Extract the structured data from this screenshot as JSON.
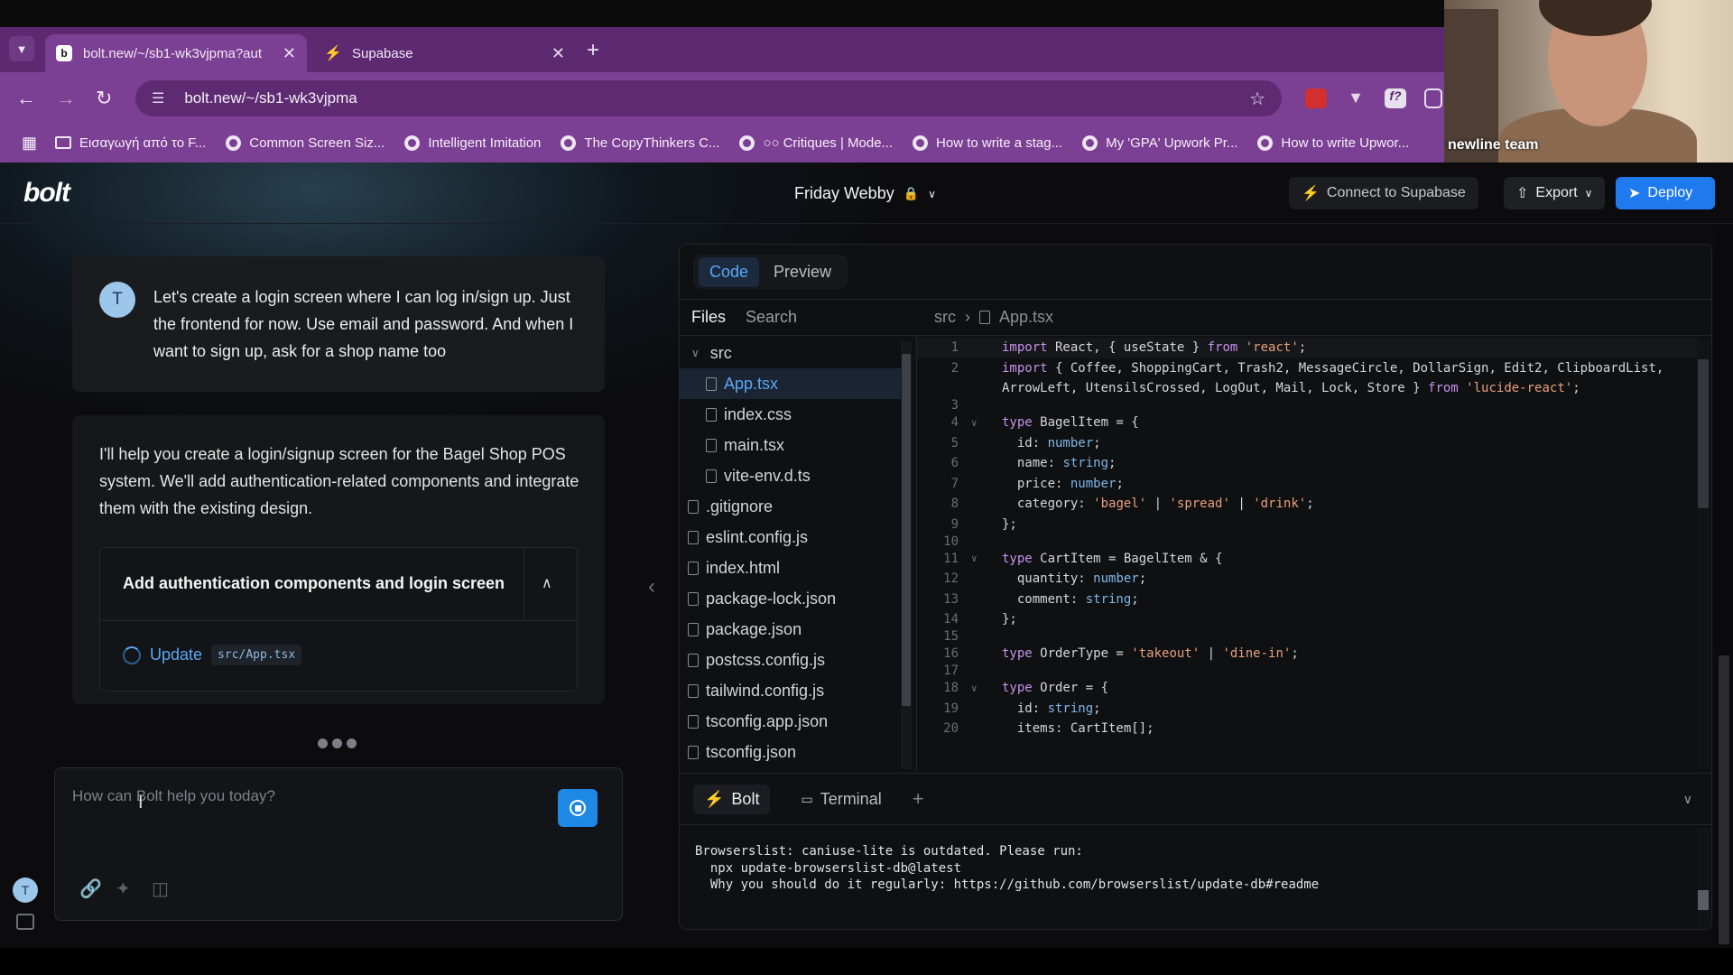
{
  "browser": {
    "tabs": [
      {
        "title": "bolt.new/~/sb1-wk3vjpma?aut",
        "favicon": "b"
      },
      {
        "title": "Supabase",
        "favicon": "supabase-icon"
      }
    ],
    "url": "bolt.new/~/sb1-wk3vjpma",
    "bookmarks": [
      "Εισαγωγή από το F...",
      "Common Screen Siz...",
      "Intelligent Imitation",
      "The CopyThinkers C...",
      "Critiques | Mode...",
      "How to write a stag...",
      "My 'GPA' Upwork Pr...",
      "How to write Upwor..."
    ],
    "theme_color": "#7b3f93"
  },
  "webcam": {
    "label": "newline team"
  },
  "app": {
    "logo": "bolt",
    "project_name": "Friday Webby",
    "connect_label": "Connect to Supabase",
    "export_label": "Export",
    "deploy_label": "Deploy",
    "accent": "#1f7af0"
  },
  "chat": {
    "user_avatar": "T",
    "user_message": "Let's create a login screen where I can log in/sign up. Just the frontend for now. Use email and password. And when I want to sign up, ask for a shop name too",
    "assistant_message": "I'll help you create a login/signup screen for the Bagel Shop POS system. We'll add authentication-related components and integrate them with the existing design.",
    "action_title": "Add authentication components and login screen",
    "action_step": "Update",
    "action_file": "src/App.tsx",
    "input_placeholder": "How can Bolt help you today?",
    "sidebar_avatar": "T"
  },
  "workbench": {
    "tabs": [
      "Code",
      "Preview"
    ],
    "active_tab": "Code",
    "file_tabs": [
      "Files",
      "Search"
    ],
    "breadcrumb": [
      "src",
      "App.tsx"
    ],
    "files": [
      {
        "name": "src",
        "type": "folder",
        "depth": 0
      },
      {
        "name": "App.tsx",
        "type": "file",
        "depth": 1,
        "selected": true
      },
      {
        "name": "index.css",
        "type": "file",
        "depth": 1
      },
      {
        "name": "main.tsx",
        "type": "file",
        "depth": 1
      },
      {
        "name": "vite-env.d.ts",
        "type": "file",
        "depth": 1
      },
      {
        "name": ".gitignore",
        "type": "file",
        "depth": 0
      },
      {
        "name": "eslint.config.js",
        "type": "file",
        "depth": 0
      },
      {
        "name": "index.html",
        "type": "file",
        "depth": 0
      },
      {
        "name": "package-lock.json",
        "type": "file",
        "depth": 0
      },
      {
        "name": "package.json",
        "type": "file",
        "depth": 0
      },
      {
        "name": "postcss.config.js",
        "type": "file",
        "depth": 0
      },
      {
        "name": "tailwind.config.js",
        "type": "file",
        "depth": 0
      },
      {
        "name": "tsconfig.app.json",
        "type": "file",
        "depth": 0
      },
      {
        "name": "tsconfig.json",
        "type": "file",
        "depth": 0
      }
    ],
    "code_lines": [
      {
        "n": "1",
        "text": "import React, { useState } from 'react';",
        "fold": false
      },
      {
        "n": "2",
        "text": "import { Coffee, ShoppingCart, Trash2, MessageCircle, DollarSign, Edit2, ClipboardList,",
        "fold": false
      },
      {
        "n": "",
        "text": "ArrowLeft, UtensilsCrossed, LogOut, Mail, Lock, Store } from 'lucide-react';",
        "fold": false
      },
      {
        "n": "3",
        "text": "",
        "fold": false
      },
      {
        "n": "4",
        "text": "type BagelItem = {",
        "fold": true
      },
      {
        "n": "5",
        "text": "  id: number;",
        "fold": false
      },
      {
        "n": "6",
        "text": "  name: string;",
        "fold": false
      },
      {
        "n": "7",
        "text": "  price: number;",
        "fold": false
      },
      {
        "n": "8",
        "text": "  category: 'bagel' | 'spread' | 'drink';",
        "fold": false
      },
      {
        "n": "9",
        "text": "};",
        "fold": false
      },
      {
        "n": "10",
        "text": "",
        "fold": false
      },
      {
        "n": "11",
        "text": "type CartItem = BagelItem & {",
        "fold": true
      },
      {
        "n": "12",
        "text": "  quantity: number;",
        "fold": false
      },
      {
        "n": "13",
        "text": "  comment: string;",
        "fold": false
      },
      {
        "n": "14",
        "text": "};",
        "fold": false
      },
      {
        "n": "15",
        "text": "",
        "fold": false
      },
      {
        "n": "16",
        "text": "type OrderType = 'takeout' | 'dine-in';",
        "fold": false
      },
      {
        "n": "17",
        "text": "",
        "fold": false
      },
      {
        "n": "18",
        "text": "type Order = {",
        "fold": true
      },
      {
        "n": "19",
        "text": "  id: string;",
        "fold": false
      },
      {
        "n": "20",
        "text": "  items: CartItem[];",
        "fold": false
      }
    ],
    "terminal_tabs": [
      "Bolt",
      "Terminal"
    ],
    "terminal_output": "Browserslist: caniuse-lite is outdated. Please run:\n  npx update-browserslist-db@latest\n  Why you should do it regularly: https://github.com/browserslist/update-db#readme"
  }
}
